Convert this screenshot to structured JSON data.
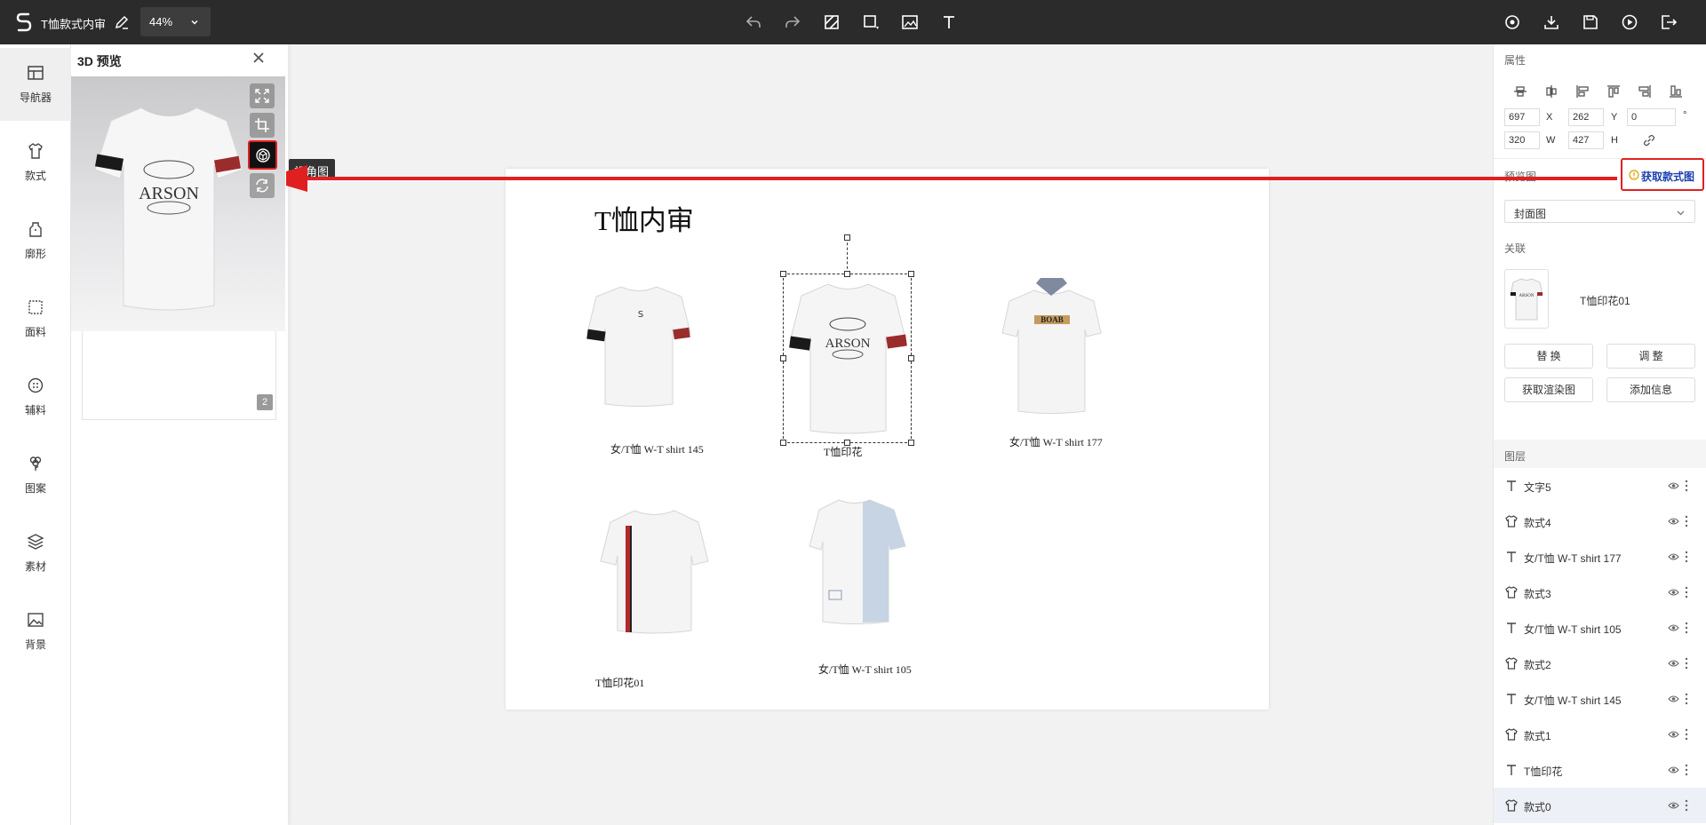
{
  "topbar": {
    "doc_title": "T恤款式内审",
    "zoom": "44%",
    "center_icons": [
      "undo-icon",
      "redo-icon",
      "hatch-icon",
      "rectangle-icon",
      "image-icon",
      "text-icon"
    ],
    "right_icons": [
      "preview-icon",
      "download-icon",
      "save-icon",
      "play-icon",
      "exit-icon"
    ]
  },
  "leftnav": {
    "items": [
      {
        "label": "导航器",
        "icon": "layout-icon"
      },
      {
        "label": "款式",
        "icon": "tshirt-icon"
      },
      {
        "label": "廓形",
        "icon": "silhouette-icon"
      },
      {
        "label": "面料",
        "icon": "fabric-icon"
      },
      {
        "label": "辅料",
        "icon": "button-icon"
      },
      {
        "label": "图案",
        "icon": "flower-icon"
      },
      {
        "label": "素材",
        "icon": "layers-icon"
      },
      {
        "label": "背景",
        "icon": "picture-icon"
      }
    ]
  },
  "panel3d": {
    "title": "3D 预览",
    "tooltip": "视角图",
    "page_badge": "2",
    "shirt_print": "ARSON"
  },
  "canvas": {
    "title": "T恤内审",
    "items": [
      {
        "label": "女/T恤 W-T shirt 145"
      },
      {
        "label": "T恤印花"
      },
      {
        "label": "女/T恤 W-T shirt 177"
      },
      {
        "label": "T恤印花01"
      },
      {
        "label": "女/T恤 W-T shirt 105"
      }
    ]
  },
  "properties": {
    "title": "属性",
    "x": "697",
    "x_unit": "X",
    "y": "262",
    "y_unit": "Y",
    "rotation": "0",
    "rotation_unit": "°",
    "w": "320",
    "w_unit": "W",
    "h": "427",
    "h_unit": "H"
  },
  "preview": {
    "title": "预览图",
    "fetch_label": "获取款式图",
    "select_value": "封面图"
  },
  "link": {
    "title": "关联",
    "name": "T恤印花01",
    "buttons": [
      "替 换",
      "调 整",
      "获取渲染图",
      "添加信息"
    ]
  },
  "layers": {
    "title": "图层",
    "items": [
      {
        "name": "文字5",
        "type": "text"
      },
      {
        "name": "款式4",
        "type": "style"
      },
      {
        "name": "女/T恤 W-T shirt 177",
        "type": "text"
      },
      {
        "name": "款式3",
        "type": "style"
      },
      {
        "name": "女/T恤 W-T shirt 105",
        "type": "text"
      },
      {
        "name": "款式2",
        "type": "style"
      },
      {
        "name": "女/T恤 W-T shirt 145",
        "type": "text"
      },
      {
        "name": "款式1",
        "type": "style"
      },
      {
        "name": "T恤印花",
        "type": "text"
      },
      {
        "name": "款式0",
        "type": "style"
      }
    ]
  },
  "colors": {
    "topbar": "#2b2b2b",
    "annotation_red": "#e02020",
    "link_blue": "#1a3fae"
  }
}
